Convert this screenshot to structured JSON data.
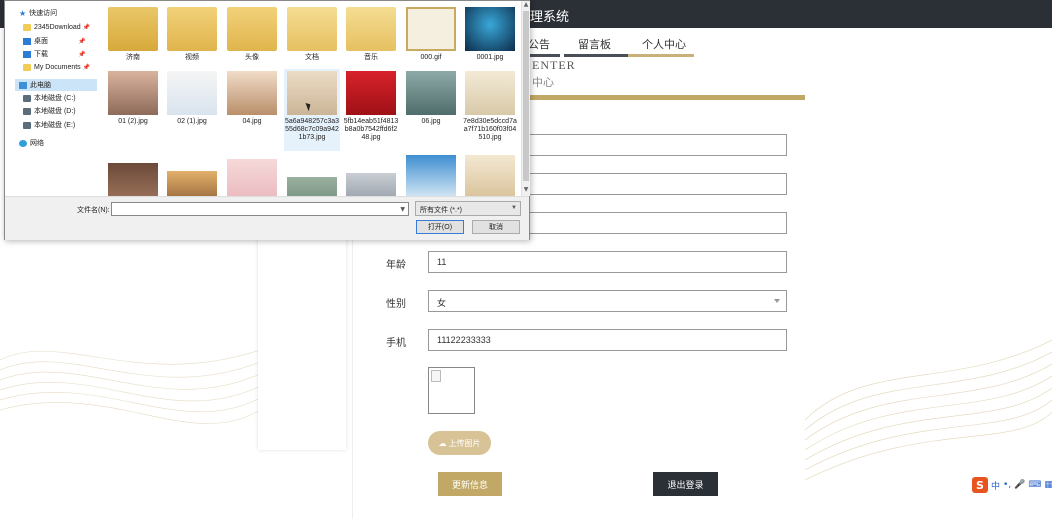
{
  "app": {
    "title_partial": "理系统",
    "nav_tabs": [
      {
        "label": "公告",
        "active": false
      },
      {
        "label": "留言板",
        "active": false
      },
      {
        "label": "个人中心",
        "active": true
      }
    ],
    "center_en": "ENTER",
    "center_cn": "中心"
  },
  "form": {
    "rows": [
      {
        "label": "",
        "value": ""
      },
      {
        "label": "",
        "value": ""
      },
      {
        "label": "",
        "value": ""
      },
      {
        "label": "年龄",
        "value": "11"
      },
      {
        "label": "性别",
        "value": "女"
      },
      {
        "label": "手机",
        "value": "11122233333"
      }
    ],
    "upload_label": "上传图片",
    "update_label": "更新信息",
    "logout_label": "退出登录"
  },
  "ime": {
    "items": [
      "中",
      "•,",
      "🎤",
      "⌨",
      "▦"
    ]
  },
  "dialog": {
    "tree": [
      {
        "label": "快速访问",
        "icon": "star"
      },
      {
        "label": "2345Download",
        "icon": "folder",
        "pinned": true
      },
      {
        "label": "桌面",
        "icon": "blue",
        "pinned": true
      },
      {
        "label": "下载",
        "icon": "blue",
        "pinned": true
      },
      {
        "label": "My Documents",
        "icon": "folder",
        "pinned": true
      },
      {
        "label": "此电脑",
        "icon": "pc",
        "selected": true
      },
      {
        "label": "本地磁盘 (C:)",
        "icon": "drive"
      },
      {
        "label": "本地磁盘 (D:)",
        "icon": "drive"
      },
      {
        "label": "本地磁盘 (E:)",
        "icon": "drive"
      },
      {
        "label": "网络",
        "icon": "net"
      }
    ],
    "files": [
      {
        "name": "济南",
        "kind": "folder"
      },
      {
        "name": "视频",
        "kind": "folder"
      },
      {
        "name": "头像",
        "kind": "folder"
      },
      {
        "name": "文档",
        "kind": "folder"
      },
      {
        "name": "音乐",
        "kind": "folder"
      },
      {
        "name": "000.gif",
        "kind": "image"
      },
      {
        "name": "0001.jpg",
        "kind": "image"
      },
      {
        "name": "01 (2).jpg",
        "kind": "image"
      },
      {
        "name": "02 (1).jpg",
        "kind": "image"
      },
      {
        "name": "04.jpg",
        "kind": "image"
      },
      {
        "name": "5a6a948257c3a355d68c7c09a9421b73.jpg",
        "kind": "image",
        "hover": true
      },
      {
        "name": "5fb14eab51f4813b8a0b7542ffd6f248.jpg",
        "kind": "image"
      },
      {
        "name": "06.jpg",
        "kind": "image"
      },
      {
        "name": "7e8d30e5dccd7aa7f71b160f03f04510.jpg",
        "kind": "image"
      },
      {
        "name": "",
        "kind": "image"
      },
      {
        "name": "",
        "kind": "image"
      },
      {
        "name": "",
        "kind": "image"
      },
      {
        "name": "",
        "kind": "image"
      },
      {
        "name": "",
        "kind": "image"
      },
      {
        "name": "",
        "kind": "image"
      },
      {
        "name": "",
        "kind": "image"
      }
    ],
    "filename_label": "文件名(N):",
    "filename_value": "",
    "filetype_label": "所有文件 (*.*)",
    "open_label": "打开(O)",
    "cancel_label": "取消"
  },
  "colors": {
    "gold": "#c2a866",
    "dark": "#2b2f36",
    "upload": "#d8c397"
  }
}
